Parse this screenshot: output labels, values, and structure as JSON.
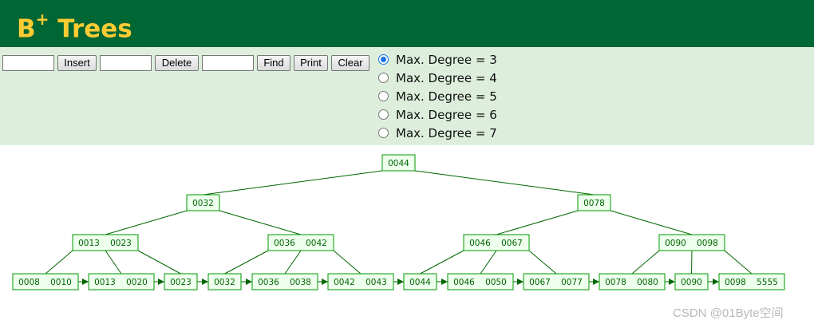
{
  "header": {
    "title": "B",
    "title_sup": "+",
    "title_rest": " Trees"
  },
  "controls": {
    "insert_value": "",
    "insert_label": "Insert",
    "delete_value": "",
    "delete_label": "Delete",
    "find_value": "",
    "find_label": "Find",
    "print_label": "Print",
    "clear_label": "Clear"
  },
  "degree_options": [
    {
      "label": "Max. Degree = 3",
      "checked": true
    },
    {
      "label": "Max. Degree = 4",
      "checked": false
    },
    {
      "label": "Max. Degree = 5",
      "checked": false
    },
    {
      "label": "Max. Degree = 6",
      "checked": false
    },
    {
      "label": "Max. Degree = 7",
      "checked": false
    }
  ],
  "tree": {
    "colors": {
      "node_fill": "#eeffee",
      "node_stroke": "#009900",
      "text": "#006600",
      "edge": "#006600"
    },
    "levels": [
      [
        [
          "0044"
        ]
      ],
      [
        [
          "0032"
        ],
        [
          "0078"
        ]
      ],
      [
        [
          "0013",
          "0023"
        ],
        [
          "0036",
          "0042"
        ],
        [
          "0046",
          "0067"
        ],
        [
          "0090",
          "0098"
        ]
      ],
      [
        [
          "0008",
          "0010"
        ],
        [
          "0013",
          "0020"
        ],
        [
          "0023"
        ],
        [
          "0032"
        ],
        [
          "0036",
          "0038"
        ],
        [
          "0042",
          "0043"
        ],
        [
          "0044"
        ],
        [
          "0046",
          "0050"
        ],
        [
          "0067",
          "0077"
        ],
        [
          "0078",
          "0080"
        ],
        [
          "0090"
        ],
        [
          "0098",
          "5555"
        ]
      ]
    ]
  },
  "watermark": "CSDN @01Byte空间"
}
